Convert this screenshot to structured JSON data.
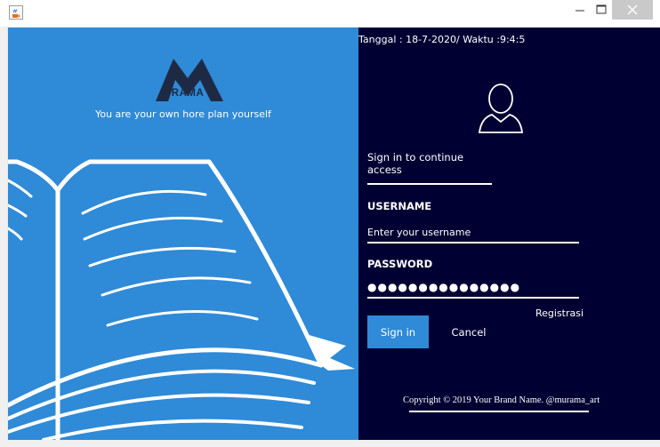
{
  "window": {
    "app_icon": "java-cup-icon",
    "controls": {
      "minimize": "minimize-icon",
      "maximize": "maximize-icon",
      "close": "close-icon"
    }
  },
  "brand": {
    "logo_text": "URAMA",
    "tagline": "You are your own hore plan yourself",
    "color": "#2f8ad7",
    "panel_dark": "#000033"
  },
  "header": {
    "datetime": "Tanggal : 18-7-2020/  Waktu :9:4:5"
  },
  "login": {
    "user_icon": "user-avatar-icon",
    "subtitle": "Sign in to continue access",
    "username_label": "USERNAME",
    "username_placeholder": "Enter your username",
    "password_label": "PASSWORD",
    "password_value": "●●●●●●●●●●●●●●●",
    "register_label": "Registrasi",
    "signin_label": "Sign in",
    "cancel_label": "Cancel"
  },
  "footer": {
    "copyright": "Copyright © 2019 Your Brand Name. @murama_art"
  }
}
